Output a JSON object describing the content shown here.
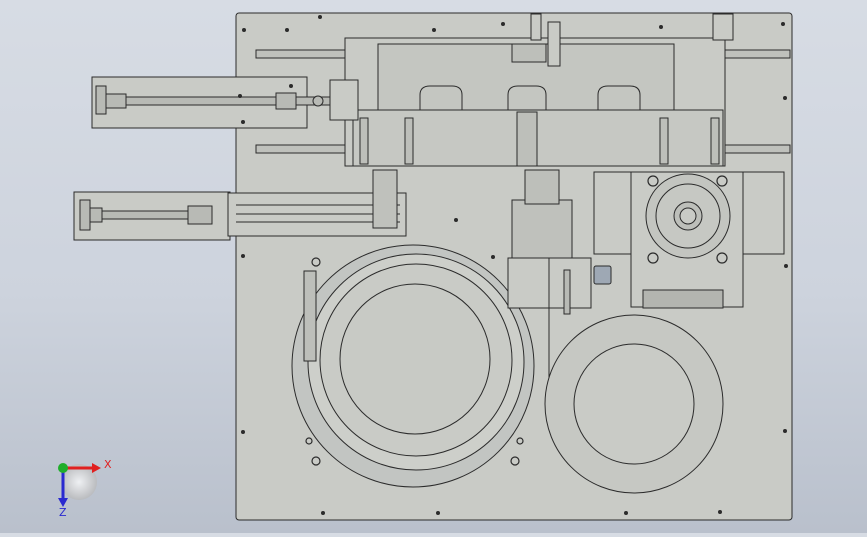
{
  "viewport": {
    "background_top": "#d7dce4",
    "background_bottom": "#b9c0cc",
    "part_fill": "#c9cbc6",
    "line_color": "#2b2b2b"
  },
  "triad": {
    "x_label": "X",
    "z_label": "Z",
    "x_color": "#e02020",
    "y_color": "#1fae2a",
    "z_color": "#2a2ad0"
  }
}
